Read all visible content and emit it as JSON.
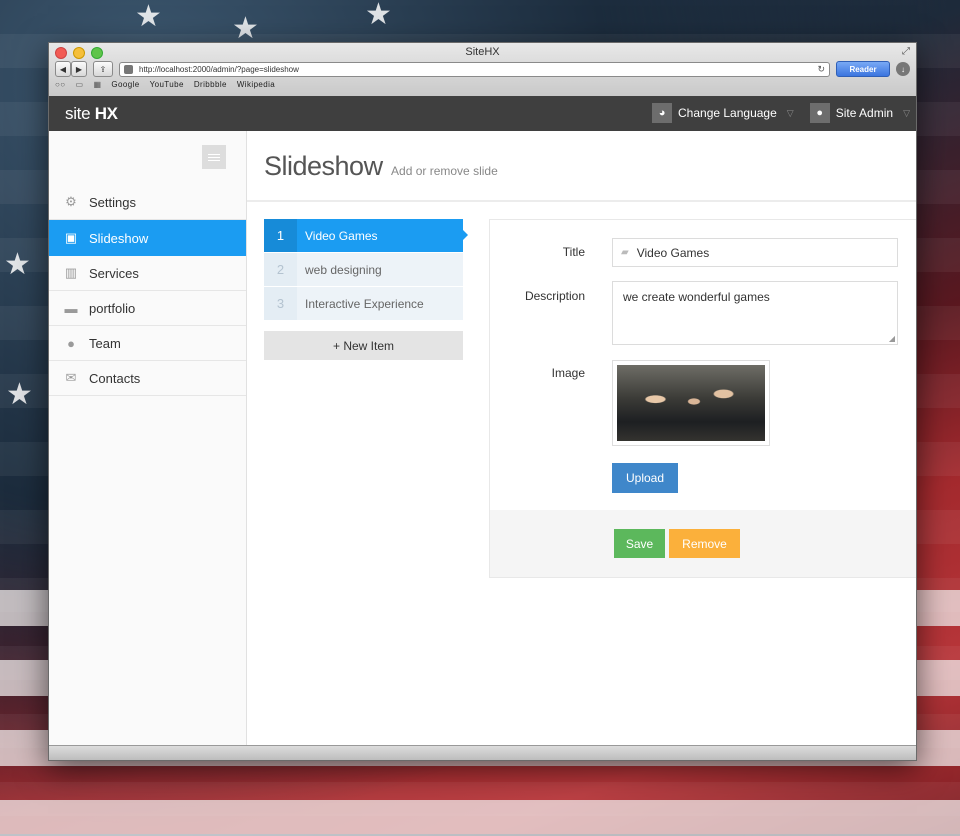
{
  "browser": {
    "window_title": "SiteHX",
    "url": "http://localhost:2000/admin/?page=slideshow",
    "reader_label": "Reader",
    "bookmarks": [
      "Google",
      "YouTube",
      "Dribbble",
      "Wikipedia"
    ]
  },
  "app": {
    "brand_part1": "site",
    "brand_part2": "HX",
    "language_menu": "Change Language",
    "user_menu": "Site Admin"
  },
  "sidebar": {
    "items": [
      {
        "label": "Settings",
        "icon": "gears-icon",
        "active": false
      },
      {
        "label": "Slideshow",
        "icon": "image-icon",
        "active": true
      },
      {
        "label": "Services",
        "icon": "gift-icon",
        "active": false
      },
      {
        "label": "portfolio",
        "icon": "briefcase-icon",
        "active": false
      },
      {
        "label": "Team",
        "icon": "user-icon",
        "active": false
      },
      {
        "label": "Contacts",
        "icon": "envelope-icon",
        "active": false
      }
    ]
  },
  "page": {
    "title": "Slideshow",
    "subtitle": "Add or remove slide"
  },
  "slides": [
    {
      "num": "1",
      "label": "Video Games",
      "active": true
    },
    {
      "num": "2",
      "label": "web designing",
      "active": false
    },
    {
      "num": "3",
      "label": "Interactive Experience",
      "active": false
    }
  ],
  "new_item_label": "+ New Item",
  "form": {
    "title_label": "Title",
    "title_value": "Video Games",
    "description_label": "Description",
    "description_value": "we create wonderful games",
    "image_label": "Image",
    "upload_label": "Upload",
    "save_label": "Save",
    "remove_label": "Remove"
  },
  "colors": {
    "accent": "#1b9cf2",
    "header": "#3f3f3f",
    "save": "#5cb85c",
    "remove": "#fbb03b",
    "upload": "#3f87ca"
  }
}
